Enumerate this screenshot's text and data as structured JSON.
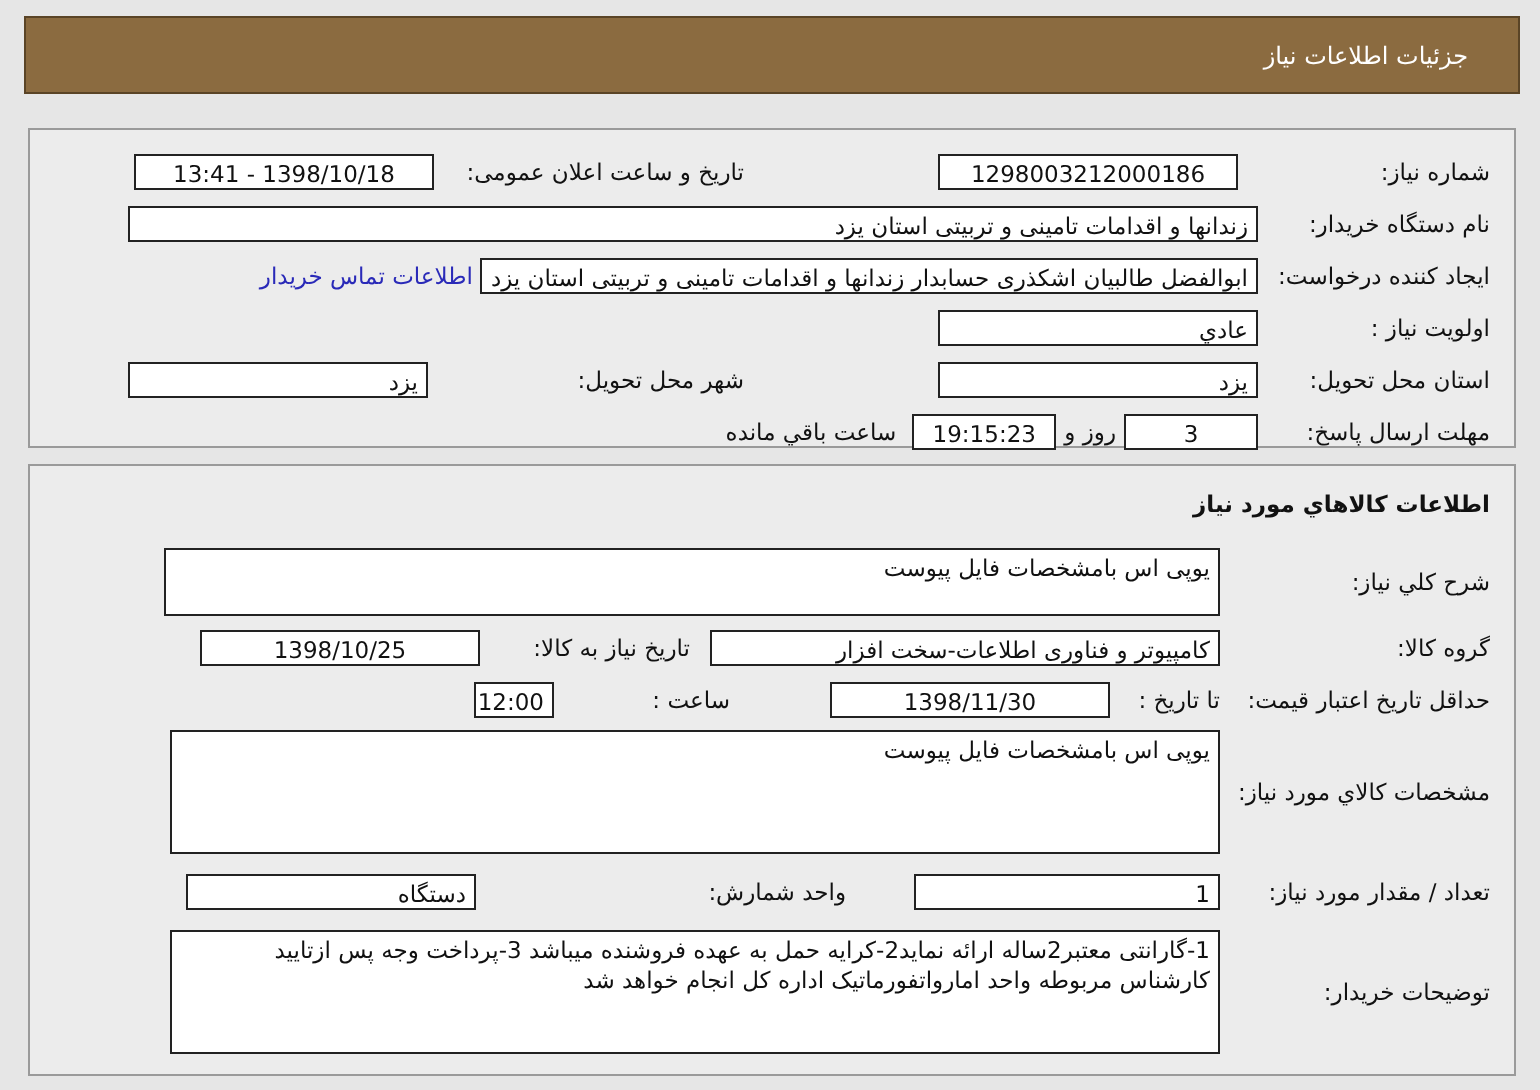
{
  "header": {
    "title": "جزئیات اطلاعات نیاز"
  },
  "request": {
    "need_number": {
      "label": "شماره نیاز:",
      "value": "1298003212000186"
    },
    "announce_date": {
      "label": "تاریخ و ساعت اعلان عمومی:",
      "value": "1398/10/18 - 13:41"
    },
    "buyer_org": {
      "label": "نام دستگاه خریدار:",
      "value": "زندانها و اقدامات تامینی و تربیتی استان یزد"
    },
    "creator": {
      "label": "ایجاد کننده درخواست:",
      "value": "ابوالفضل  طالبیان اشکذری حسابدار زندانها و اقدامات تامینی و تربیتی استان یزد",
      "link": "اطلاعات تماس خریدار"
    },
    "priority": {
      "label": "اولویت نیاز :",
      "value": "عادي"
    },
    "province": {
      "label": "استان محل تحویل:",
      "value": "یزد"
    },
    "city": {
      "label": "شهر محل تحویل:",
      "value": "یزد"
    },
    "deadline": {
      "label": "مهلت ارسال پاسخ:",
      "days": "3",
      "days_suffix": "روز و",
      "time": "19:15:23",
      "time_suffix": "ساعت باقي مانده"
    }
  },
  "goods": {
    "title": "اطلاعات کالاهاي مورد نیاز",
    "description": {
      "label": "شرح کلي نیاز:",
      "value": "یوپی اس بامشخصات فایل پیوست"
    },
    "group": {
      "label": "گروه کالا:",
      "value": "کامپیوتر و فناوری اطلاعات-سخت افزار"
    },
    "need_date": {
      "label": "تاریخ نیاز به کالا:",
      "value": "1398/10/25"
    },
    "price_validity": {
      "label": "حداقل تاریخ اعتبار قیمت:",
      "date_label": "تا تاریخ :",
      "date": "1398/11/30",
      "time_label": "ساعت :",
      "time": "12:00"
    },
    "specs": {
      "label": "مشخصات کالاي مورد نیاز:",
      "value": "یوپی اس بامشخصات فایل پیوست"
    },
    "quantity": {
      "label": "تعداد / مقدار مورد نیاز:",
      "value": "1"
    },
    "unit": {
      "label": "واحد شمارش:",
      "value": "دستگاه"
    },
    "buyer_notes": {
      "label": "توضیحات خریدار:",
      "value": "1-گارانتی معتبر2ساله ارائه نماید2-کرایه حمل به عهده فروشنده میباشد 3-پرداخت وجه پس ازتایید کارشناس مربوطه واحد امارواتفورماتیک اداره کل انجام خواهد شد"
    }
  }
}
